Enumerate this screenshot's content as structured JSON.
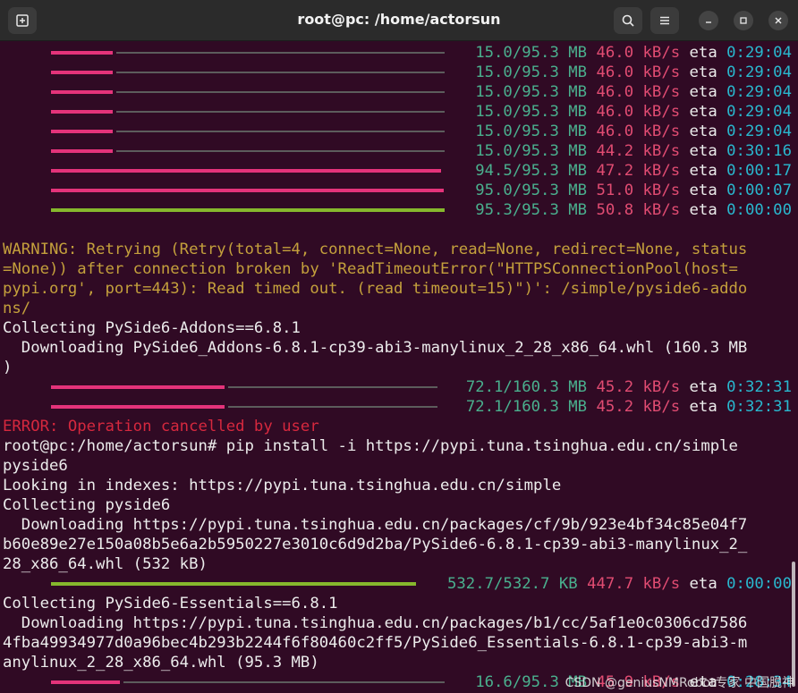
{
  "window": {
    "title": "root@pc: /home/actorsun",
    "new_tab_icon": "new-tab-icon",
    "search_icon": "search-icon",
    "menu_icon": "hamburger-menu-icon",
    "minimize_icon": "minimize-icon",
    "maximize_icon": "maximize-icon",
    "close_icon": "close-icon"
  },
  "bars": [
    {
      "progress": 0.157,
      "size": "15.0/95.3 MB",
      "rate": "46.0 kB/s",
      "eta_label": "eta",
      "eta": "0:29:04"
    },
    {
      "progress": 0.157,
      "size": "15.0/95.3 MB",
      "rate": "46.0 kB/s",
      "eta_label": "eta",
      "eta": "0:29:04"
    },
    {
      "progress": 0.157,
      "size": "15.0/95.3 MB",
      "rate": "46.0 kB/s",
      "eta_label": "eta",
      "eta": "0:29:04"
    },
    {
      "progress": 0.157,
      "size": "15.0/95.3 MB",
      "rate": "46.0 kB/s",
      "eta_label": "eta",
      "eta": "0:29:04"
    },
    {
      "progress": 0.157,
      "size": "15.0/95.3 MB",
      "rate": "46.0 kB/s",
      "eta_label": "eta",
      "eta": "0:29:04"
    },
    {
      "progress": 0.157,
      "size": "15.0/95.3 MB",
      "rate": "44.2 kB/s",
      "eta_label": "eta",
      "eta": "0:30:16"
    },
    {
      "progress": 0.992,
      "size": "94.5/95.3 MB",
      "rate": "47.2 kB/s",
      "eta_label": "eta",
      "eta": "0:00:17"
    },
    {
      "progress": 0.997,
      "size": "95.0/95.3 MB",
      "rate": "51.0 kB/s",
      "eta_label": "eta",
      "eta": "0:00:07"
    },
    {
      "progress": 1.0,
      "size": "95.3/95.3 MB",
      "rate": "50.8 kB/s",
      "eta_label": "eta",
      "eta": "0:00:00"
    },
    {
      "progress": 0.45,
      "size": "72.1/160.3 MB",
      "rate": "45.2 kB/s",
      "eta_label": "eta",
      "eta": "0:32:31"
    },
    {
      "progress": 0.45,
      "size": "72.1/160.3 MB",
      "rate": "45.2 kB/s",
      "eta_label": "eta",
      "eta": "0:32:31"
    },
    {
      "progress": 1.0,
      "size": "532.7/532.7 KB",
      "rate": "447.7 kB/s",
      "eta_label": "eta",
      "eta": "0:00:00"
    },
    {
      "progress": 0.174,
      "size": "16.6/95.3 MB",
      "rate": "45.9 kB/s",
      "eta_label": "eta",
      "eta": "0:28:34"
    }
  ],
  "lines": {
    "warning_1": "WARNING: Retrying (Retry(total=4, connect=None, read=None, redirect=None, status",
    "warning_2": "=None)) after connection broken by 'ReadTimeoutError(\"HTTPSConnectionPool(host=",
    "warning_3": "pypi.org', port=443): Read timed out. (read timeout=15)\")': /simple/pyside6-addo",
    "warning_4": "ns/",
    "collect_addons": "Collecting PySide6-Addons==6.8.1",
    "download_addons_1": "  Downloading PySide6_Addons-6.8.1-cp39-abi3-manylinux_2_28_x86_64.whl (160.3 MB",
    "download_addons_2": ")",
    "error": "ERROR: Operation cancelled by user",
    "cmd_1": "root@pc:/home/actorsun# pip install -i https://pypi.tuna.tsinghua.edu.cn/simple",
    "cmd_2": "pyside6",
    "looking": "Looking in indexes: https://pypi.tuna.tsinghua.edu.cn/simple",
    "collect_pyside6": "Collecting pyside6",
    "download_pyside6_1": "  Downloading https://pypi.tuna.tsinghua.edu.cn/packages/cf/9b/923e4bf34c85e04f7",
    "download_pyside6_2": "b60e89e27e150a08b5e6a2b5950227e3010c6d9d2ba/PySide6-6.8.1-cp39-abi3-manylinux_2_",
    "download_pyside6_3": "28_x86_64.whl (532 kB)",
    "collect_essentials": "Collecting PySide6-Essentials==6.8.1",
    "download_ess_1": "  Downloading https://pypi.tuna.tsinghua.edu.cn/packages/b1/cc/5af1e0c0306cd7586",
    "download_ess_2": "4fba49934977d0a96bec4b293b2244f6f80460c2ff5/PySide6_Essentials-6.8.1-cp39-abi3-m",
    "download_ess_3": "anylinux_2_28_x86_64.whl (95.3 MB)"
  },
  "watermark": "CSDN @geniusNMRobot专家 中国脱神"
}
